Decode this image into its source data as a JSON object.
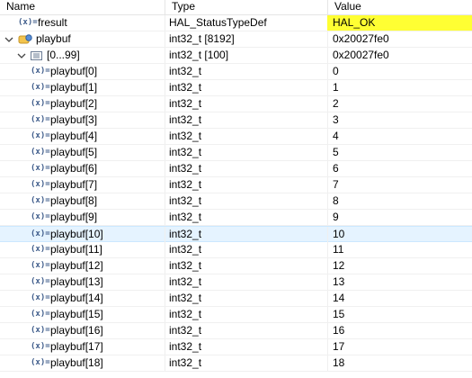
{
  "columns": {
    "name": "Name",
    "type": "Type",
    "value": "Value"
  },
  "icons": {
    "variable": "(x)=",
    "expanded": "⌄",
    "collapsed": "›"
  },
  "colors": {
    "highlight": "#ffff33",
    "selection": "#e5f3ff"
  },
  "rows": [
    {
      "name": "fresult",
      "type": "HAL_StatusTypeDef",
      "value": "HAL_OK",
      "kind": "var",
      "depth": 0,
      "highlight": true
    },
    {
      "name": "playbuf",
      "type": "int32_t [8192]",
      "value": "0x20027fe0",
      "kind": "ptr",
      "depth": 0,
      "expanded": true
    },
    {
      "name": "[0...99]",
      "type": "int32_t [100]",
      "value": "0x20027fe0",
      "kind": "arr",
      "depth": 1,
      "expanded": true
    },
    {
      "name": "playbuf[0]",
      "type": "int32_t",
      "value": "0",
      "kind": "var",
      "depth": 2
    },
    {
      "name": "playbuf[1]",
      "type": "int32_t",
      "value": "1",
      "kind": "var",
      "depth": 2
    },
    {
      "name": "playbuf[2]",
      "type": "int32_t",
      "value": "2",
      "kind": "var",
      "depth": 2
    },
    {
      "name": "playbuf[3]",
      "type": "int32_t",
      "value": "3",
      "kind": "var",
      "depth": 2
    },
    {
      "name": "playbuf[4]",
      "type": "int32_t",
      "value": "4",
      "kind": "var",
      "depth": 2
    },
    {
      "name": "playbuf[5]",
      "type": "int32_t",
      "value": "5",
      "kind": "var",
      "depth": 2
    },
    {
      "name": "playbuf[6]",
      "type": "int32_t",
      "value": "6",
      "kind": "var",
      "depth": 2
    },
    {
      "name": "playbuf[7]",
      "type": "int32_t",
      "value": "7",
      "kind": "var",
      "depth": 2
    },
    {
      "name": "playbuf[8]",
      "type": "int32_t",
      "value": "8",
      "kind": "var",
      "depth": 2
    },
    {
      "name": "playbuf[9]",
      "type": "int32_t",
      "value": "9",
      "kind": "var",
      "depth": 2
    },
    {
      "name": "playbuf[10]",
      "type": "int32_t",
      "value": "10",
      "kind": "var",
      "depth": 2,
      "selected": true
    },
    {
      "name": "playbuf[11]",
      "type": "int32_t",
      "value": "11",
      "kind": "var",
      "depth": 2
    },
    {
      "name": "playbuf[12]",
      "type": "int32_t",
      "value": "12",
      "kind": "var",
      "depth": 2
    },
    {
      "name": "playbuf[13]",
      "type": "int32_t",
      "value": "13",
      "kind": "var",
      "depth": 2
    },
    {
      "name": "playbuf[14]",
      "type": "int32_t",
      "value": "14",
      "kind": "var",
      "depth": 2
    },
    {
      "name": "playbuf[15]",
      "type": "int32_t",
      "value": "15",
      "kind": "var",
      "depth": 2
    },
    {
      "name": "playbuf[16]",
      "type": "int32_t",
      "value": "16",
      "kind": "var",
      "depth": 2
    },
    {
      "name": "playbuf[17]",
      "type": "int32_t",
      "value": "17",
      "kind": "var",
      "depth": 2
    },
    {
      "name": "playbuf[18]",
      "type": "int32_t",
      "value": "18",
      "kind": "var",
      "depth": 2
    }
  ]
}
